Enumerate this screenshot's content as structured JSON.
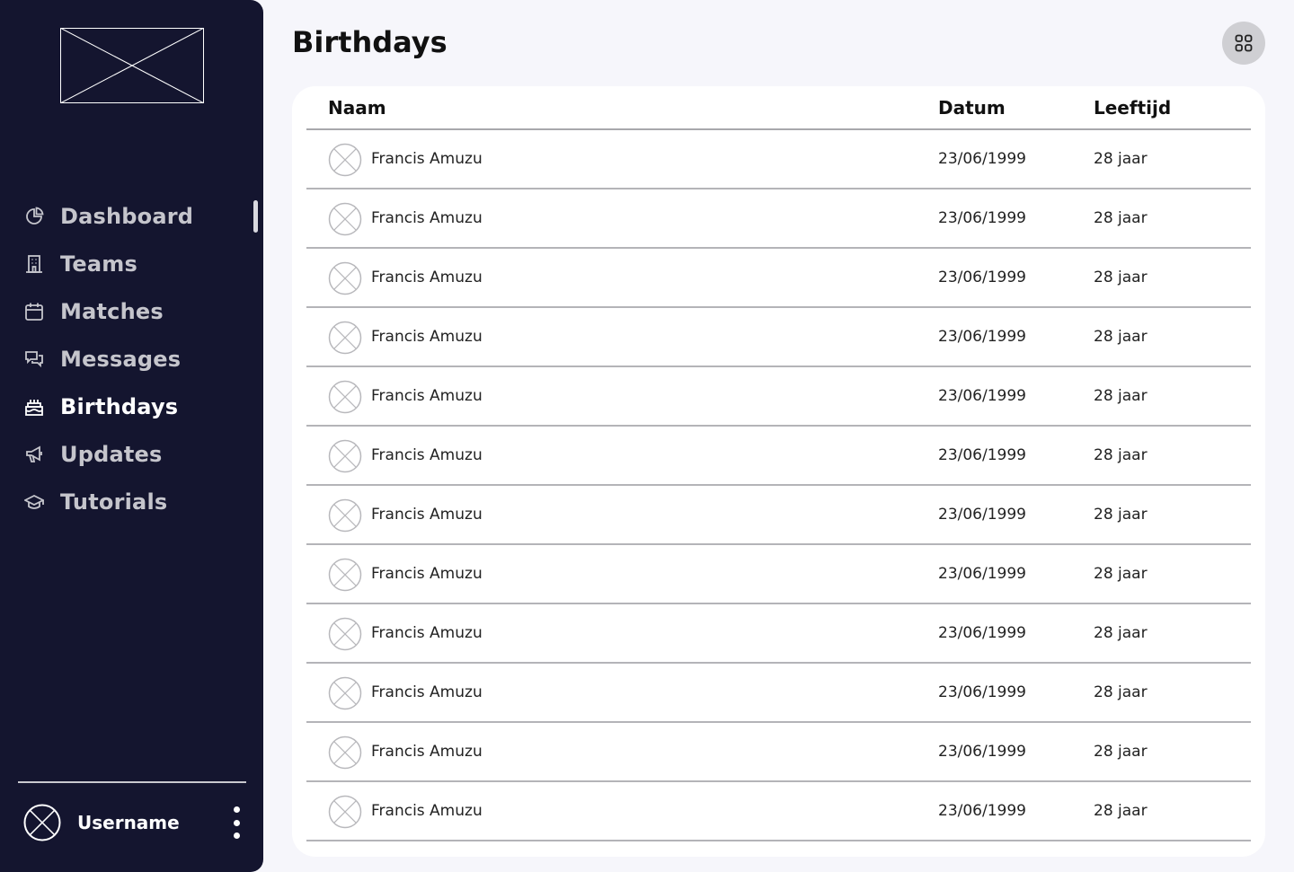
{
  "sidebar": {
    "nav": [
      {
        "label": "Dashboard",
        "icon": "pie-chart-icon",
        "active": false
      },
      {
        "label": "Teams",
        "icon": "building-icon",
        "active": false
      },
      {
        "label": "Matches",
        "icon": "calendar-icon",
        "active": false
      },
      {
        "label": "Messages",
        "icon": "chat-icon",
        "active": false
      },
      {
        "label": "Birthdays",
        "icon": "cake-icon",
        "active": true
      },
      {
        "label": "Updates",
        "icon": "megaphone-icon",
        "active": false
      },
      {
        "label": "Tutorials",
        "icon": "graduation-cap-icon",
        "active": false
      }
    ],
    "user": {
      "name": "Username"
    }
  },
  "header": {
    "title": "Birthdays"
  },
  "table": {
    "columns": [
      "Naam",
      "Datum",
      "Leeftijd"
    ],
    "rows": [
      {
        "name": "Francis Amuzu",
        "date": "23/06/1999",
        "age": "28 jaar"
      },
      {
        "name": "Francis Amuzu",
        "date": "23/06/1999",
        "age": "28 jaar"
      },
      {
        "name": "Francis Amuzu",
        "date": "23/06/1999",
        "age": "28 jaar"
      },
      {
        "name": "Francis Amuzu",
        "date": "23/06/1999",
        "age": "28 jaar"
      },
      {
        "name": "Francis Amuzu",
        "date": "23/06/1999",
        "age": "28 jaar"
      },
      {
        "name": "Francis Amuzu",
        "date": "23/06/1999",
        "age": "28 jaar"
      },
      {
        "name": "Francis Amuzu",
        "date": "23/06/1999",
        "age": "28 jaar"
      },
      {
        "name": "Francis Amuzu",
        "date": "23/06/1999",
        "age": "28 jaar"
      },
      {
        "name": "Francis Amuzu",
        "date": "23/06/1999",
        "age": "28 jaar"
      },
      {
        "name": "Francis Amuzu",
        "date": "23/06/1999",
        "age": "28 jaar"
      },
      {
        "name": "Francis Amuzu",
        "date": "23/06/1999",
        "age": "28 jaar"
      },
      {
        "name": "Francis Amuzu",
        "date": "23/06/1999",
        "age": "28 jaar"
      }
    ]
  },
  "colors": {
    "sidebar_bg": "#14152f",
    "page_bg": "#f6f6fb",
    "card_bg": "#ffffff",
    "nav_inactive": "#c5c5cc",
    "nav_active": "#ffffff"
  }
}
